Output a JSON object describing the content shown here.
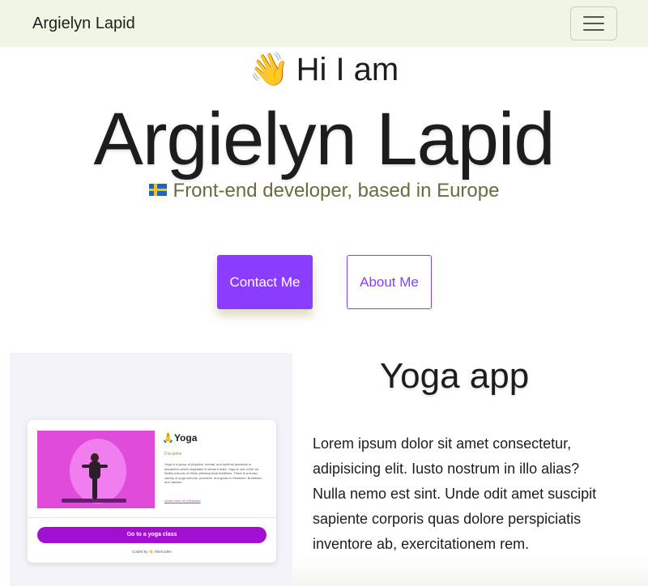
{
  "navbar": {
    "brand": "Argielyn Lapid"
  },
  "hero": {
    "greeting_emoji": "👋",
    "greeting": "Hi I am",
    "name": "Argielyn Lapid",
    "tagline": "Front-end developer, based in Europe",
    "flag_icon": "sweden-flag-icon"
  },
  "buttons": {
    "contact_label": "Contact Me",
    "about_label": "About Me"
  },
  "project": {
    "title": "Yoga app",
    "description": "Lorem ipsum dolor sit amet consectetur, adipisicing elit. Iusto nostrum in illo alias? Nulla nemo est sint. Unde odit amet suscipit sapiente corporis quas dolore perspiciatis inventore ab, exercitationem rem.",
    "card": {
      "title": "🙏Yoga",
      "subtitle": "Discipline",
      "text": "Yoga is a group of physical, mental, and spiritual practices or disciplines which originated in ancient India. Yoga is one of the six Āstika schools of Hindu philosophical traditions. There is a broad variety of yoga schools, practices, and goals in Hinduism, Buddhism, and Jainism.",
      "link": "Learn more on Wikipedia",
      "button": "Go to a yoga class",
      "footer": "Coded by 👋 SheCodes"
    }
  },
  "colors": {
    "navbar_bg": "#f1f5e4",
    "accent": "#8a3cff",
    "tagline": "#6b6b3f",
    "card_button": "#a10fd0"
  }
}
